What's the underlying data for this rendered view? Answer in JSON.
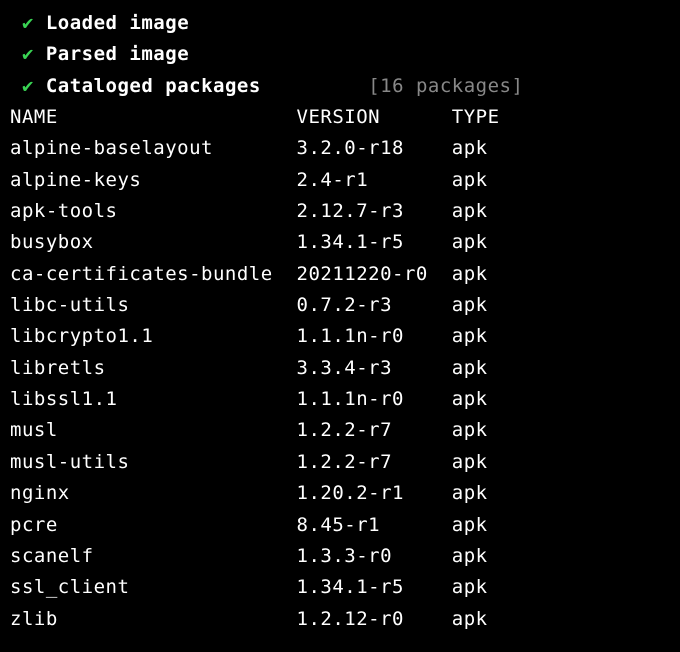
{
  "steps": [
    {
      "check": "✔",
      "label": "Loaded image",
      "suffix": ""
    },
    {
      "check": "✔",
      "label": "Parsed image",
      "suffix": ""
    },
    {
      "check": "✔",
      "label": "Cataloged packages",
      "suffix": "[16 packages]"
    }
  ],
  "columns": {
    "name": "NAME",
    "version": "VERSION",
    "type": "TYPE"
  },
  "packages": [
    {
      "name": "alpine-baselayout",
      "version": "3.2.0-r18",
      "type": "apk"
    },
    {
      "name": "alpine-keys",
      "version": "2.4-r1",
      "type": "apk"
    },
    {
      "name": "apk-tools",
      "version": "2.12.7-r3",
      "type": "apk"
    },
    {
      "name": "busybox",
      "version": "1.34.1-r5",
      "type": "apk"
    },
    {
      "name": "ca-certificates-bundle",
      "version": "20211220-r0",
      "type": "apk"
    },
    {
      "name": "libc-utils",
      "version": "0.7.2-r3",
      "type": "apk"
    },
    {
      "name": "libcrypto1.1",
      "version": "1.1.1n-r0",
      "type": "apk"
    },
    {
      "name": "libretls",
      "version": "3.3.4-r3",
      "type": "apk"
    },
    {
      "name": "libssl1.1",
      "version": "1.1.1n-r0",
      "type": "apk"
    },
    {
      "name": "musl",
      "version": "1.2.2-r7",
      "type": "apk"
    },
    {
      "name": "musl-utils",
      "version": "1.2.2-r7",
      "type": "apk"
    },
    {
      "name": "nginx",
      "version": "1.20.2-r1",
      "type": "apk"
    },
    {
      "name": "pcre",
      "version": "8.45-r1",
      "type": "apk"
    },
    {
      "name": "scanelf",
      "version": "1.3.3-r0",
      "type": "apk"
    },
    {
      "name": "ssl_client",
      "version": "1.34.1-r5",
      "type": "apk"
    },
    {
      "name": "zlib",
      "version": "1.2.12-r0",
      "type": "apk"
    }
  ],
  "layout": {
    "nameWidth": 24,
    "versionWidth": 13,
    "typeWidth": 5,
    "stepIndent": " ",
    "labelPad": 27
  }
}
